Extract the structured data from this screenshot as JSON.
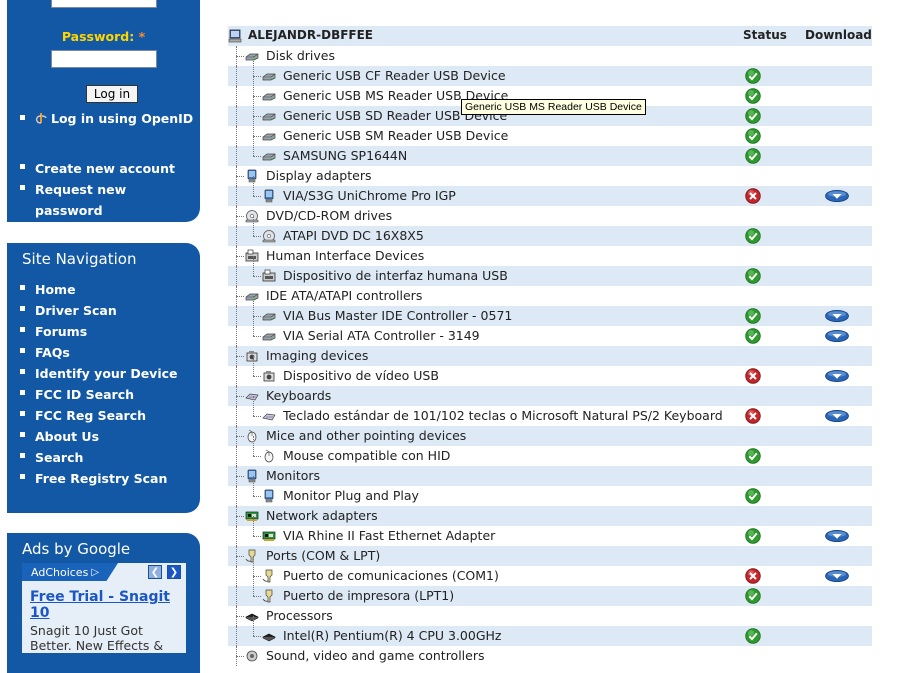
{
  "sidebar": {
    "login": {
      "password_label": "Password:",
      "required_mark": "*",
      "login_button": "Log in",
      "links": [
        "Log in using OpenID",
        "Create new account",
        "Request new password"
      ]
    },
    "navigation": {
      "title": "Site Navigation",
      "items": [
        "Home",
        "Driver Scan",
        "Forums",
        "FAQs",
        "Identify your Device",
        "FCC ID Search",
        "FCC Reg Search",
        "About Us",
        "Search",
        "Free Registry Scan"
      ]
    },
    "ads": {
      "title": "Ads by Google",
      "adchoices": "AdChoices",
      "ad_title": "Free Trial - Snagit 10",
      "ad_text": "Snagit 10 Just Got Better. New Effects &"
    }
  },
  "tree": {
    "computer": "ALEJANDR-DBFFEE",
    "status_header": "Status",
    "download_header": "Download",
    "tooltip": "Generic USB MS Reader USB Device",
    "rows": [
      {
        "type": "cat",
        "label": "Disk drives",
        "icon": "disk-icon"
      },
      {
        "type": "dev",
        "label": "Generic USB CF Reader USB Device",
        "icon": "disk-icon",
        "status": "ok",
        "download": false
      },
      {
        "type": "dev",
        "label": "Generic USB MS Reader USB Device",
        "icon": "disk-icon",
        "status": "ok",
        "download": false
      },
      {
        "type": "dev",
        "label": "Generic USB SD Reader USB Device",
        "icon": "disk-icon",
        "status": "ok",
        "download": false
      },
      {
        "type": "dev",
        "label": "Generic USB SM Reader USB Device",
        "icon": "disk-icon",
        "status": "ok",
        "download": false
      },
      {
        "type": "dev",
        "label": "SAMSUNG SP1644N",
        "icon": "disk-icon",
        "status": "ok",
        "download": false
      },
      {
        "type": "cat",
        "label": "Display adapters",
        "icon": "display-icon"
      },
      {
        "type": "dev",
        "label": "VIA/S3G UniChrome Pro IGP",
        "icon": "display-icon",
        "status": "error",
        "download": true
      },
      {
        "type": "cat",
        "label": "DVD/CD-ROM drives",
        "icon": "cdrom-icon"
      },
      {
        "type": "dev",
        "label": "ATAPI DVD DC 16X8X5",
        "icon": "cdrom-icon",
        "status": "ok",
        "download": false
      },
      {
        "type": "cat",
        "label": "Human Interface Devices",
        "icon": "hid-icon"
      },
      {
        "type": "dev",
        "label": "Dispositivo de interfaz humana USB",
        "icon": "hid-icon",
        "status": "ok",
        "download": false
      },
      {
        "type": "cat",
        "label": "IDE ATA/ATAPI controllers",
        "icon": "disk-icon"
      },
      {
        "type": "dev",
        "label": "VIA Bus Master IDE Controller - 0571",
        "icon": "disk-icon",
        "status": "ok",
        "download": true
      },
      {
        "type": "dev",
        "label": "VIA Serial ATA Controller - 3149",
        "icon": "disk-icon",
        "status": "ok",
        "download": true
      },
      {
        "type": "cat",
        "label": "Imaging devices",
        "icon": "camera-icon"
      },
      {
        "type": "dev",
        "label": "Dispositivo de vídeo USB",
        "icon": "camera-icon",
        "status": "error",
        "download": true
      },
      {
        "type": "cat",
        "label": "Keyboards",
        "icon": "keyboard-icon"
      },
      {
        "type": "dev",
        "label": "Teclado estándar de 101/102 teclas o Microsoft Natural PS/2 Keyboard",
        "icon": "keyboard-icon",
        "status": "error",
        "download": true
      },
      {
        "type": "cat",
        "label": "Mice and other pointing devices",
        "icon": "mouse-icon"
      },
      {
        "type": "dev",
        "label": "Mouse compatible con HID",
        "icon": "mouse-icon",
        "status": "ok",
        "download": false
      },
      {
        "type": "cat",
        "label": "Monitors",
        "icon": "display-icon"
      },
      {
        "type": "dev",
        "label": "Monitor Plug and Play",
        "icon": "display-icon",
        "status": "ok",
        "download": false
      },
      {
        "type": "cat",
        "label": "Network adapters",
        "icon": "network-icon"
      },
      {
        "type": "dev",
        "label": "VIA Rhine II Fast Ethernet Adapter",
        "icon": "network-icon",
        "status": "ok",
        "download": true
      },
      {
        "type": "cat",
        "label": "Ports (COM & LPT)",
        "icon": "port-icon"
      },
      {
        "type": "dev",
        "label": "Puerto de comunicaciones (COM1)",
        "icon": "port-icon",
        "status": "error",
        "download": true
      },
      {
        "type": "dev",
        "label": "Puerto de impresora (LPT1)",
        "icon": "port-icon",
        "status": "ok",
        "download": false
      },
      {
        "type": "cat",
        "label": "Processors",
        "icon": "cpu-icon"
      },
      {
        "type": "dev",
        "label": "Intel(R) Pentium(R) 4 CPU 3.00GHz",
        "icon": "cpu-icon",
        "status": "ok",
        "download": false
      },
      {
        "type": "cat",
        "label": "Sound, video and game controllers",
        "icon": "sound-icon"
      }
    ]
  },
  "colors": {
    "sidebar_blue": "#1358a5",
    "row_shade": "#dde9f5",
    "ok_green": "#2e9a2e",
    "error_red": "#c0262a",
    "password_yellow": "#ffd700"
  }
}
